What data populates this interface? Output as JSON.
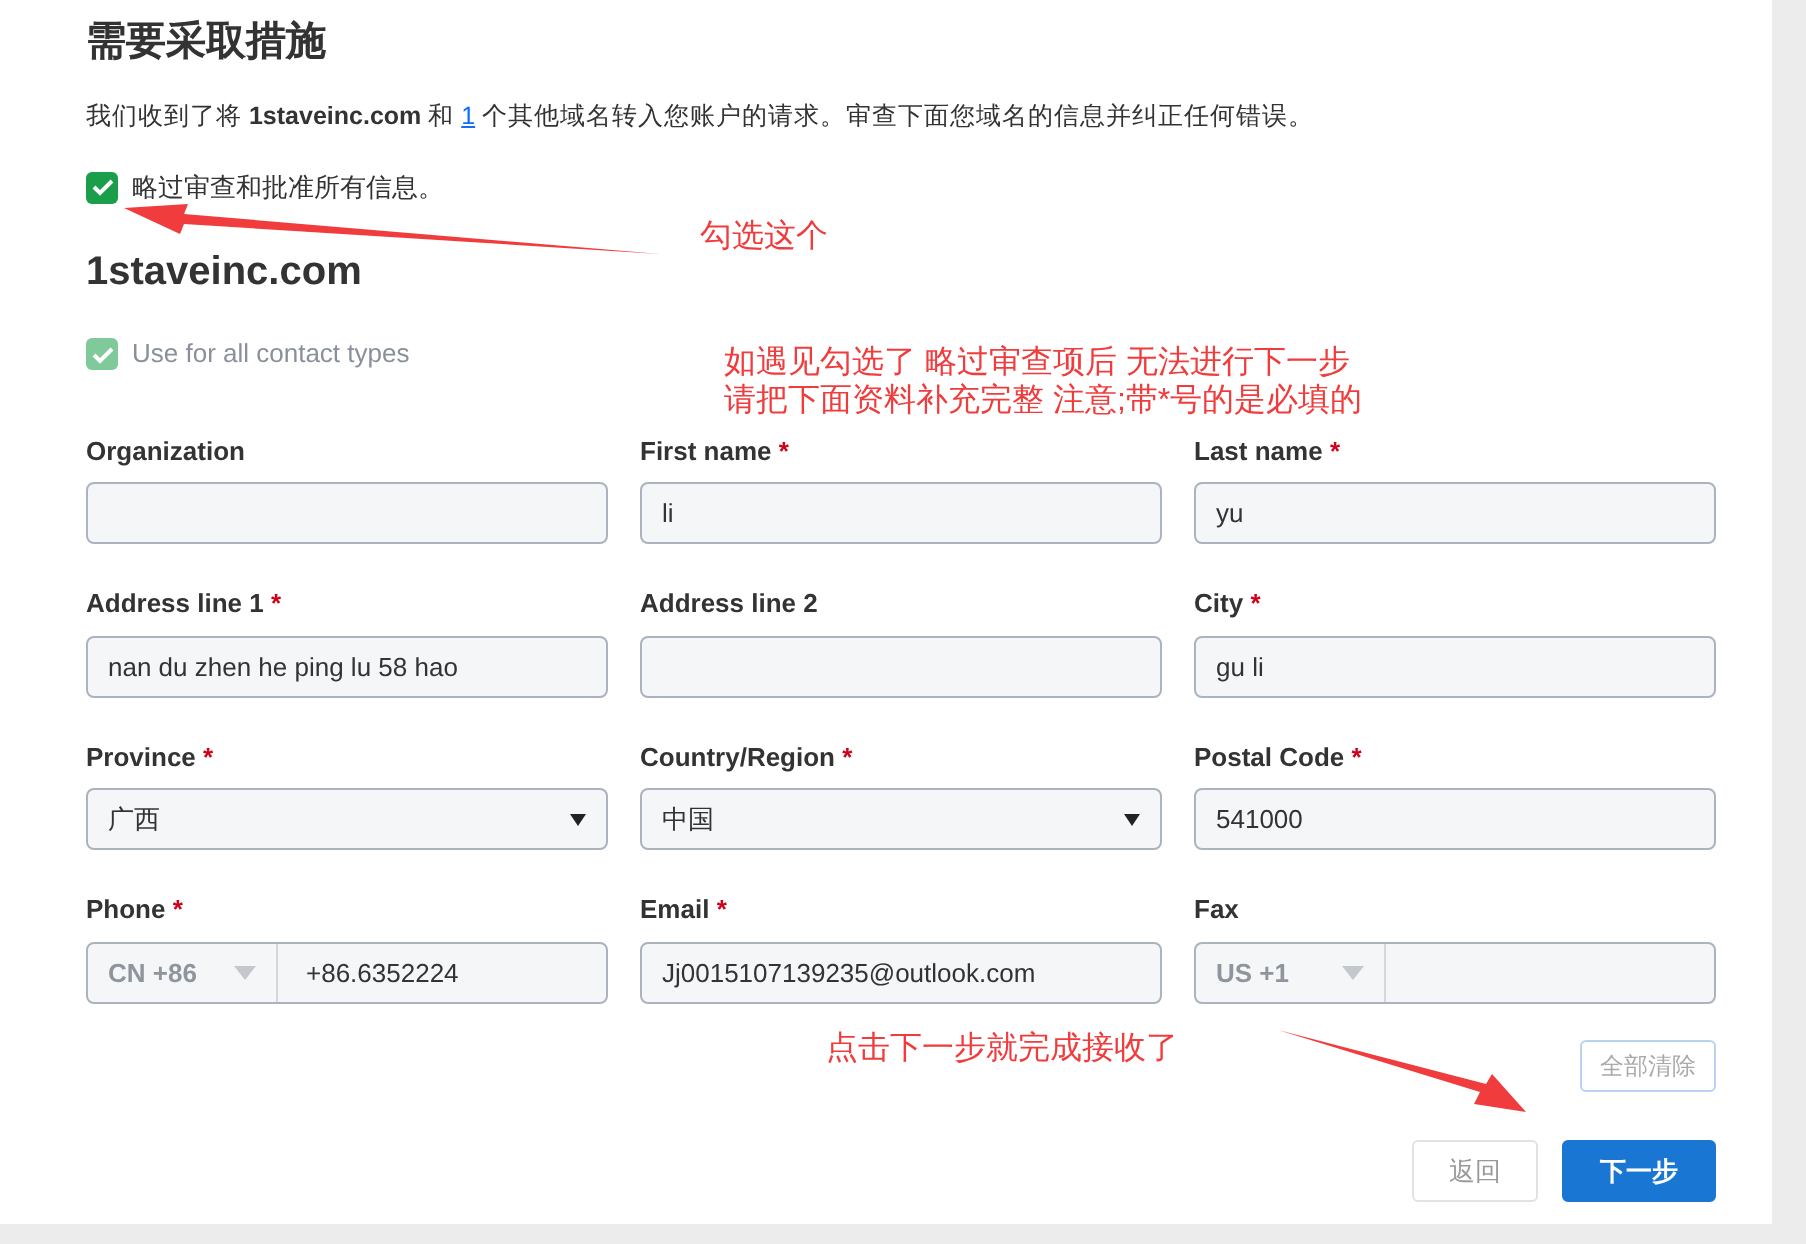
{
  "heading": "需要采取措施",
  "intro": {
    "before": "我们收到了将 **1staveinc.com** 和 ",
    "link": "1",
    "after": " 个其他域名转入您账户的请求。审查下面您域名的信息并纠正任何错误。"
  },
  "skip_review": {
    "label": "略过审查和批准所有信息。",
    "checked": true
  },
  "domain": "1staveinc.com",
  "use_all": {
    "label": "Use for all contact types",
    "checked": true,
    "disabled": true
  },
  "fields": [
    {
      "label": "Organization",
      "kind": "text"
    },
    {
      "label": "First name",
      "mark": "*",
      "kind": "text",
      "value": "li"
    },
    {
      "label": "Last name",
      "mark": "*",
      "kind": "text",
      "value": "yu"
    },
    {
      "label": "Address line 1",
      "mark": "*",
      "kind": "text",
      "value": "nan du zhen he ping lu 58 hao"
    },
    {
      "label": "Address line 2",
      "kind": "text"
    },
    {
      "label": "City",
      "mark": "*",
      "kind": "text",
      "value": "gu li"
    },
    {
      "label": "Province",
      "mark": "*",
      "kind": "select",
      "value": "广西"
    },
    {
      "label": "Country/Region",
      "mark": "*",
      "kind": "select",
      "value": "中国"
    },
    {
      "label": "Postal Code",
      "mark": "*",
      "kind": "text",
      "value": "541000"
    },
    {
      "label": "Phone",
      "mark": "*",
      "kind": "phone",
      "country": "CN +86",
      "value": "+86.6352224"
    },
    {
      "label": "Email",
      "mark": "*",
      "kind": "text",
      "value": "Jj0015107139235@outlook.com"
    },
    {
      "label": "Fax",
      "kind": "phone",
      "country": "US +1"
    }
  ],
  "clear_button": {
    "label": "全部清除",
    "disabled": true
  },
  "buttons": [
    {
      "label": "返回",
      "kind": "secondary",
      "disabled": true
    },
    {
      "label": "下一步",
      "kind": "primary",
      "disabled": false
    }
  ],
  "annotations": [
    {
      "text": "勾选这个",
      "kind": "arrow-left"
    },
    {
      "text": "如遇见勾选了 略过审查项后 无法进行下一步",
      "kind": "note"
    },
    {
      "text": "请把下面资料补充完整 注意;带*号的是必填的",
      "kind": "note"
    },
    {
      "text": "点击下一步就完成接收了",
      "kind": "arrow-right"
    }
  ]
}
